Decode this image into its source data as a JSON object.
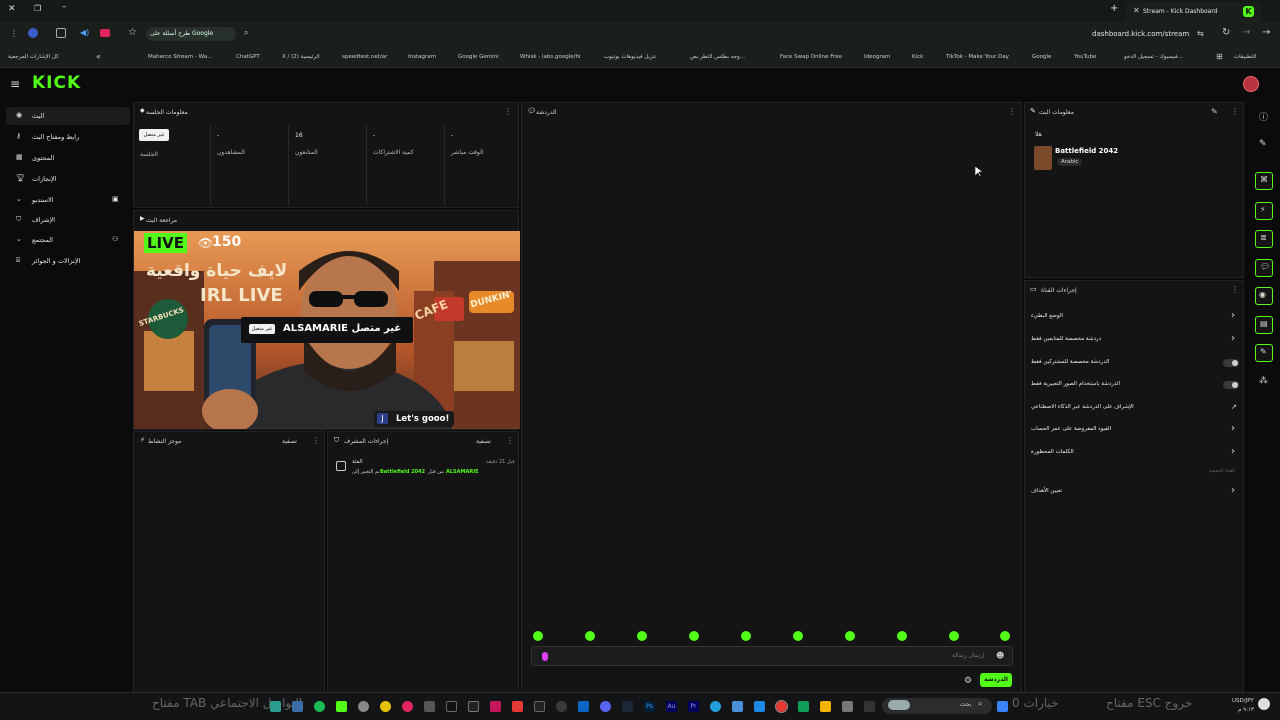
{
  "browser": {
    "tab_title": "Stream - Kick Dashboard",
    "url": "dashboard.kick.com/stream",
    "search_chip": "طرح أسئلة على Google",
    "bookmarks": [
      "Maherco Stream - Wa...",
      "ChatGPT",
      "X / (2) الرئيسية",
      "speedtest.net/ar",
      "Instagram",
      "Google Gemini",
      "Whisk - labs.google/fx",
      "تنزيل فيديوهات يوتيوب",
      "وجه بطلس التطر بص...",
      "Face Swap Online Free",
      "Ideogram",
      "Kick",
      "TikTok - Make Your Day",
      "Google",
      "YouTube",
      "فيسبوك - تسجيل الدخو..."
    ],
    "bookmarks_apps": "التطبيقات",
    "bookmarks_all": "كل الإشارات المرجعية"
  },
  "brand": {
    "logo": "KICK",
    "accent": "#53fc18"
  },
  "sidebar": {
    "items": [
      {
        "label": "البث",
        "icon": "broadcast-icon"
      },
      {
        "label": "رابط ومفتاح البث",
        "icon": "key-icon"
      },
      {
        "label": "المحتوى",
        "icon": "content-icon"
      },
      {
        "label": "الإنجازات",
        "icon": "trophy-icon"
      },
      {
        "label": "الاستديو",
        "icon": "studio-icon"
      },
      {
        "label": "الإشراف",
        "icon": "shield-icon"
      },
      {
        "label": "المجتمع",
        "icon": "community-icon"
      },
      {
        "label": "الإنزالات و الجوائز",
        "icon": "gift-icon"
      }
    ]
  },
  "session": {
    "title": "معلومات الجلسة",
    "stats": [
      {
        "value": "غير متصل",
        "label": "الجلسة"
      },
      {
        "value": "-",
        "label": "المشاهدون"
      },
      {
        "value": "16",
        "label": "المتابعون"
      },
      {
        "value": "-",
        "label": "كمية الاشتراكات"
      },
      {
        "value": "-",
        "label": "الوقت مباشر"
      }
    ]
  },
  "preview": {
    "title": "مراجعة البث",
    "live": "LIVE",
    "viewers": "150",
    "line1": "لايف حياة واقعية",
    "line2": "IRL LIVE",
    "offline_badge": "غير متصل",
    "offline_text": "ALSAMARIE غير متصل",
    "caption": "Let's gooo!",
    "caption_user": "J",
    "sign_left": "STARBUCKS",
    "sign_cafe": "CAFE",
    "sign_dunkin": "DUNKIN'"
  },
  "activity": {
    "title": "موجز النشاط",
    "filter": "تصفية"
  },
  "modlog": {
    "title": "إجراءات المشرف",
    "filter": "تصفية",
    "entry_time": "قبل 21 دقيقة",
    "entry_type": "الفئة",
    "entry_user": "ALSAMARIE",
    "entry_game": "Battlefield 2042",
    "entry_from": "من قبل",
    "entry_rest": "تم التغيير إلى"
  },
  "chat": {
    "title": "الدردشة",
    "placeholder": "إرسال رسالة",
    "send": "الدردشة"
  },
  "streaminfo": {
    "title": "معلومات البث",
    "subtitle": "هلا",
    "game": "Battlefield 2042",
    "lang": "Arabic"
  },
  "channel": {
    "title": "إجراءات القناة",
    "rows": [
      {
        "label": "الوضع البطيء",
        "type": "chevron"
      },
      {
        "label": "دردشة مخصصة للمتابعين فقط",
        "type": "chevron"
      },
      {
        "label": "الدردشة مخصصة للمشتركين فقط",
        "type": "toggle"
      },
      {
        "label": "الدردشة باستخدام الصور التعبيرية فقط",
        "type": "toggle"
      },
      {
        "label": "الإشراف على الدردشة عبر الذكاء الاصطناعي",
        "type": "external"
      },
      {
        "label": "القيود المفروضة على عمر الحساب",
        "type": "chevron"
      },
      {
        "label": "الكلمات المحظورة",
        "type": "chevron"
      }
    ],
    "caption": "القناة المحمية",
    "goals": "تعيين الأهداف"
  },
  "taskbar": {
    "overlay_left": "مفتاح TAB التواصل الاجتماعي",
    "overlay_right": "مفتاح ESC خروج",
    "overlay_right2": "0 خيارات",
    "search": "بحث",
    "clock_lang": "USD/JPY",
    "clock_time": "٩:١٣ م"
  }
}
